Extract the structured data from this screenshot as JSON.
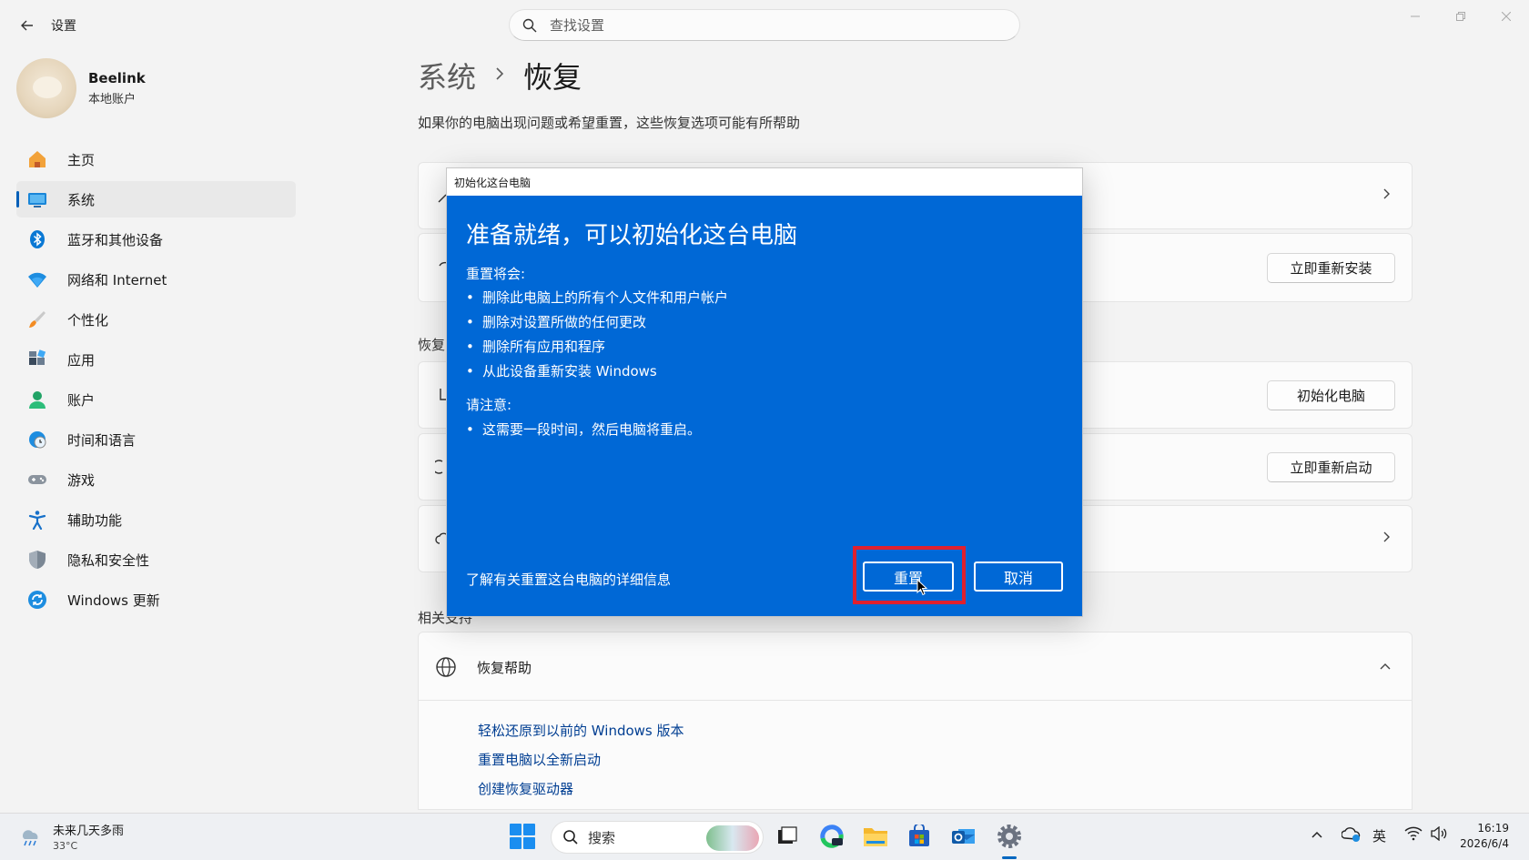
{
  "window": {
    "app_title": "设置",
    "search_placeholder": "查找设置"
  },
  "profile": {
    "name": "Beelink",
    "account_type": "本地账户"
  },
  "sidebar": {
    "items": [
      {
        "label": "主页",
        "icon": "home-icon"
      },
      {
        "label": "系统",
        "icon": "system-icon",
        "active": true
      },
      {
        "label": "蓝牙和其他设备",
        "icon": "bluetooth-icon"
      },
      {
        "label": "网络和 Internet",
        "icon": "wifi-icon"
      },
      {
        "label": "个性化",
        "icon": "brush-icon"
      },
      {
        "label": "应用",
        "icon": "apps-icon"
      },
      {
        "label": "账户",
        "icon": "account-icon"
      },
      {
        "label": "时间和语言",
        "icon": "globe-clock-icon"
      },
      {
        "label": "游戏",
        "icon": "gamepad-icon"
      },
      {
        "label": "辅助功能",
        "icon": "accessibility-icon"
      },
      {
        "label": "隐私和安全性",
        "icon": "shield-icon"
      },
      {
        "label": "Windows 更新",
        "icon": "update-icon"
      }
    ]
  },
  "page": {
    "breadcrumb_parent": "系统",
    "breadcrumb_current": "恢复",
    "subtitle": "如果你的电脑出现问题或希望重置，这些恢复选项可能有所帮助",
    "section_recovery": "恢复",
    "section_related": "相关支持",
    "buttons": {
      "reinstall": "立即重新安装",
      "reset_pc": "初始化电脑",
      "restart_now": "立即重新启动"
    },
    "help": {
      "title": "恢复帮助",
      "links": [
        "轻松还原到以前的 Windows 版本",
        "重置电脑以全新启动",
        "创建恢复驱动器"
      ]
    }
  },
  "dialog": {
    "title": "初始化这台电脑",
    "heading": "准备就绪，可以初始化这台电脑",
    "will_label": "重置将会:",
    "will_items": [
      "删除此电脑上的所有个人文件和用户帐户",
      "删除对设置所做的任何更改",
      "删除所有应用和程序",
      "从此设备重新安装 Windows"
    ],
    "note_label": "请注意:",
    "note_items": [
      "这需要一段时间，然后电脑将重启。"
    ],
    "learn_more": "了解有关重置这台电脑的详细信息",
    "reset_button": "重置",
    "cancel_button": "取消",
    "highlight_color": "#e0202e"
  },
  "taskbar": {
    "weather_desc": "未来几天多雨",
    "weather_temp": "33°C",
    "search_label": "搜索",
    "input_method": "英",
    "time": "16:19",
    "date": "2026/6/4"
  },
  "colors": {
    "accent": "#005fb8",
    "dialog_blue": "#0068d6"
  }
}
